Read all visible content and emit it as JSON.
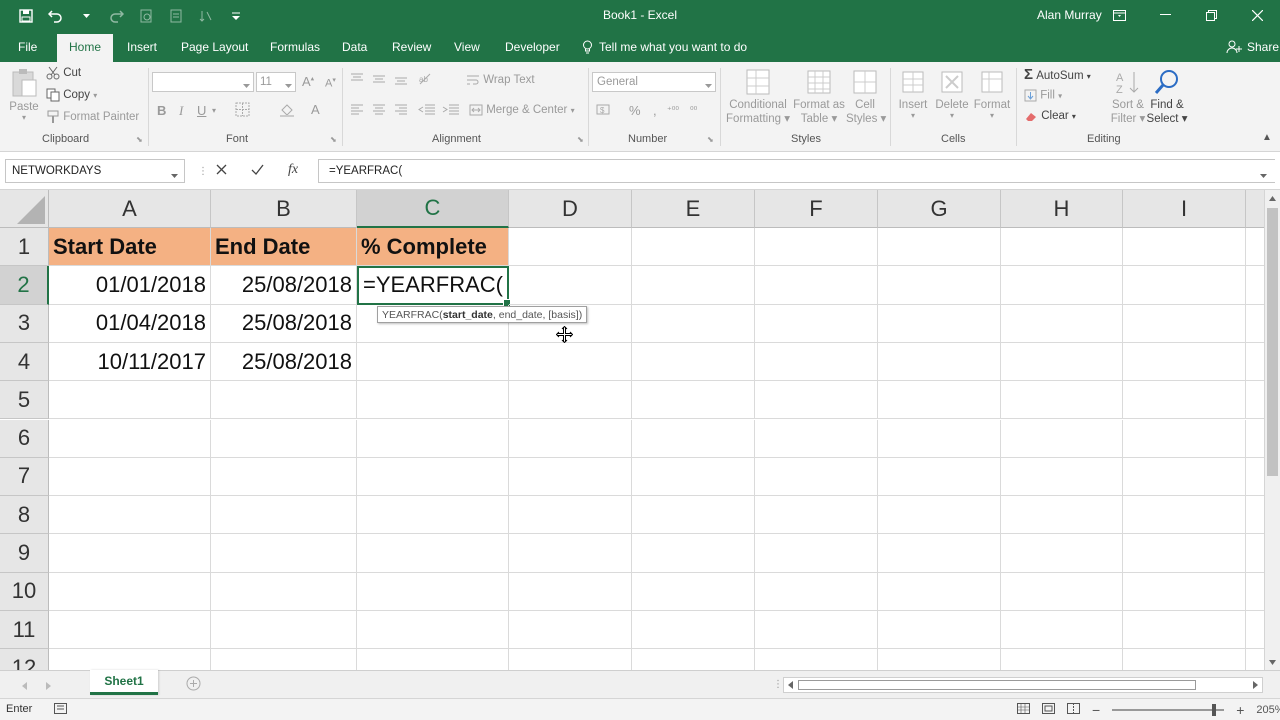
{
  "window": {
    "title": "Book1 - Excel",
    "user": "Alan Murray"
  },
  "tabs": [
    "File",
    "Home",
    "Insert",
    "Page Layout",
    "Formulas",
    "Data",
    "Review",
    "View",
    "Developer"
  ],
  "tell_me": "Tell me what you want to do",
  "share": "Share",
  "ribbon": {
    "clipboard": {
      "paste": "Paste",
      "cut": "Cut",
      "copy": "Copy",
      "format_painter": "Format Painter",
      "label": "Clipboard"
    },
    "font": {
      "size": "11",
      "label": "Font"
    },
    "alignment": {
      "wrap_text": "Wrap Text",
      "merge_center": "Merge & Center",
      "label": "Alignment"
    },
    "number": {
      "format": "General",
      "label": "Number"
    },
    "styles": {
      "cond_fmt_1": "Conditional",
      "cond_fmt_2": "Formatting",
      "fmt_table_1": "Format as",
      "fmt_table_2": "Table",
      "cell_styles_1": "Cell",
      "cell_styles_2": "Styles",
      "label": "Styles"
    },
    "cells": {
      "insert": "Insert",
      "delete": "Delete",
      "format": "Format",
      "label": "Cells"
    },
    "editing": {
      "autosum": "AutoSum",
      "fill": "Fill",
      "clear": "Clear",
      "sort_1": "Sort &",
      "sort_2": "Filter",
      "find_1": "Find &",
      "find_2": "Select",
      "label": "Editing"
    }
  },
  "formula_bar": {
    "name_box": "NETWORKDAYS",
    "formula": "=YEARFRAC("
  },
  "grid": {
    "columns": [
      "A",
      "B",
      "C",
      "D",
      "E",
      "F",
      "G",
      "H",
      "I"
    ],
    "rows": [
      "1",
      "2",
      "3",
      "4",
      "5",
      "6",
      "7",
      "8",
      "9",
      "10",
      "11",
      "12"
    ],
    "header_row": [
      "Start Date",
      "End Date",
      "% Complete"
    ],
    "data": [
      [
        "01/01/2018",
        "25/08/2018",
        "=YEARFRAC("
      ],
      [
        "01/04/2018",
        "25/08/2018",
        ""
      ],
      [
        "10/11/2017",
        "25/08/2018",
        ""
      ]
    ],
    "tooltip": {
      "fn": "YEARFRAC(",
      "arg_active": "start_date",
      "rest": ", end_date, [basis])"
    }
  },
  "sheets": [
    "Sheet1"
  ],
  "status": {
    "mode": "Enter",
    "zoom": "205%"
  },
  "colors": {
    "excel_green": "#217346",
    "header_fill": "#f4b183"
  }
}
